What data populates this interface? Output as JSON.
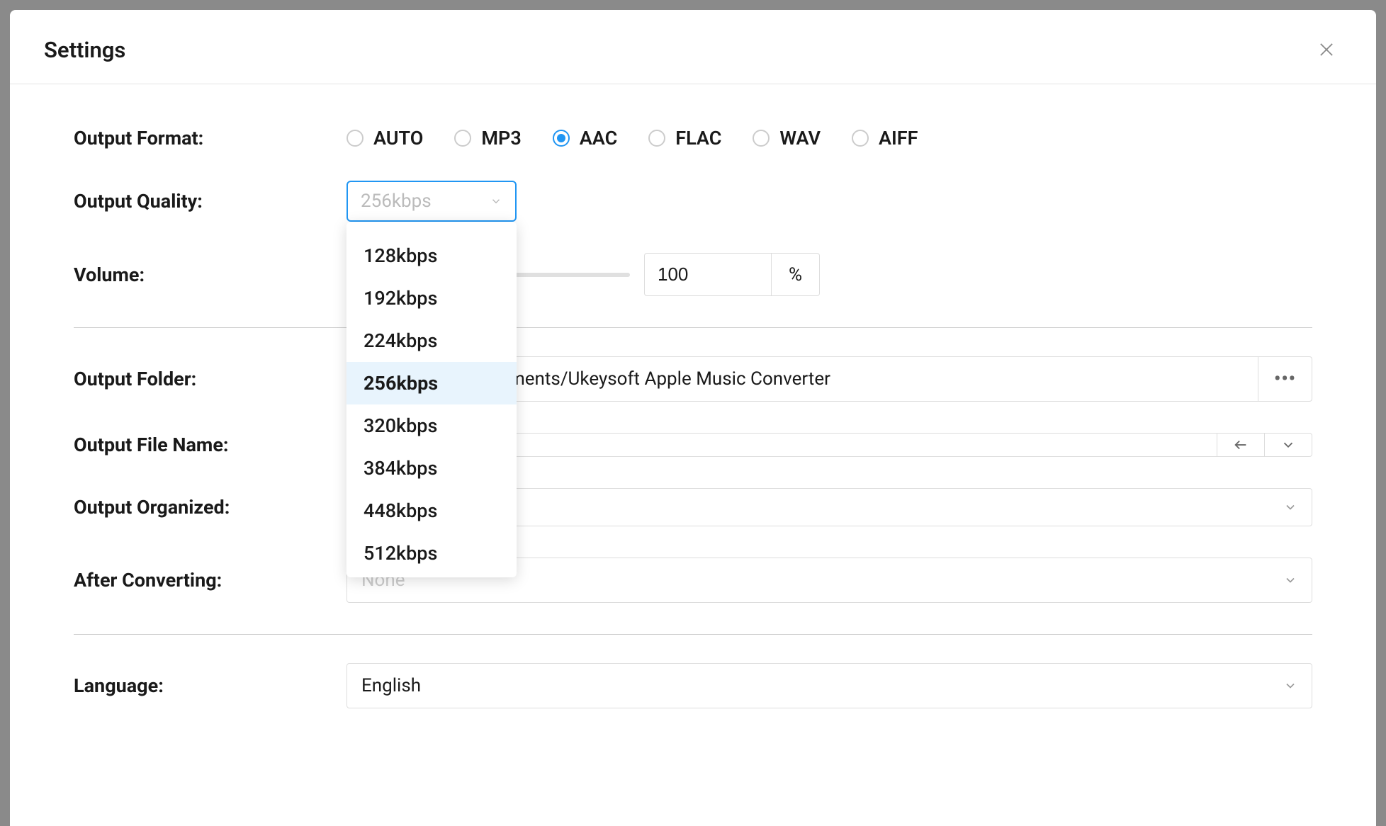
{
  "modal": {
    "title": "Settings"
  },
  "labels": {
    "output_format": "Output Format:",
    "output_quality": "Output Quality:",
    "volume": "Volume:",
    "output_folder": "Output Folder:",
    "output_file_name": "Output File Name:",
    "output_organized": "Output Organized:",
    "after_converting": "After Converting:",
    "language": "Language:"
  },
  "output_format": {
    "options": [
      "AUTO",
      "MP3",
      "AAC",
      "FLAC",
      "WAV",
      "AIFF"
    ],
    "selected": "AAC"
  },
  "output_quality": {
    "selected": "256kbps",
    "options": [
      "128kbps",
      "192kbps",
      "224kbps",
      "256kbps",
      "320kbps",
      "384kbps",
      "448kbps",
      "512kbps"
    ]
  },
  "volume": {
    "value": "100",
    "unit": "%"
  },
  "output_folder": {
    "value_suffix": "cuments/Ukeysoft Apple Music Converter"
  },
  "output_file_name": {
    "value": ""
  },
  "output_organized": {
    "value": ""
  },
  "after_converting": {
    "value": "None"
  },
  "language": {
    "value": "English"
  }
}
